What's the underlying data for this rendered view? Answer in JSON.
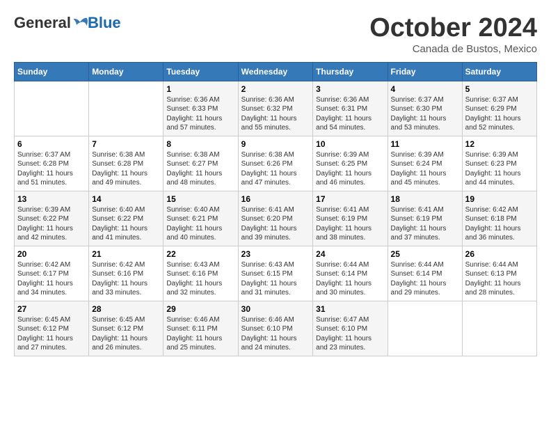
{
  "logo": {
    "general": "General",
    "blue": "Blue"
  },
  "title": "October 2024",
  "subtitle": "Canada de Bustos, Mexico",
  "days": [
    "Sunday",
    "Monday",
    "Tuesday",
    "Wednesday",
    "Thursday",
    "Friday",
    "Saturday"
  ],
  "weeks": [
    [
      {
        "day": "",
        "sunrise": "",
        "sunset": "",
        "daylight": ""
      },
      {
        "day": "",
        "sunrise": "",
        "sunset": "",
        "daylight": ""
      },
      {
        "day": "1",
        "sunrise": "Sunrise: 6:36 AM",
        "sunset": "Sunset: 6:33 PM",
        "daylight": "Daylight: 11 hours and 57 minutes."
      },
      {
        "day": "2",
        "sunrise": "Sunrise: 6:36 AM",
        "sunset": "Sunset: 6:32 PM",
        "daylight": "Daylight: 11 hours and 55 minutes."
      },
      {
        "day": "3",
        "sunrise": "Sunrise: 6:36 AM",
        "sunset": "Sunset: 6:31 PM",
        "daylight": "Daylight: 11 hours and 54 minutes."
      },
      {
        "day": "4",
        "sunrise": "Sunrise: 6:37 AM",
        "sunset": "Sunset: 6:30 PM",
        "daylight": "Daylight: 11 hours and 53 minutes."
      },
      {
        "day": "5",
        "sunrise": "Sunrise: 6:37 AM",
        "sunset": "Sunset: 6:29 PM",
        "daylight": "Daylight: 11 hours and 52 minutes."
      }
    ],
    [
      {
        "day": "6",
        "sunrise": "Sunrise: 6:37 AM",
        "sunset": "Sunset: 6:28 PM",
        "daylight": "Daylight: 11 hours and 51 minutes."
      },
      {
        "day": "7",
        "sunrise": "Sunrise: 6:38 AM",
        "sunset": "Sunset: 6:28 PM",
        "daylight": "Daylight: 11 hours and 49 minutes."
      },
      {
        "day": "8",
        "sunrise": "Sunrise: 6:38 AM",
        "sunset": "Sunset: 6:27 PM",
        "daylight": "Daylight: 11 hours and 48 minutes."
      },
      {
        "day": "9",
        "sunrise": "Sunrise: 6:38 AM",
        "sunset": "Sunset: 6:26 PM",
        "daylight": "Daylight: 11 hours and 47 minutes."
      },
      {
        "day": "10",
        "sunrise": "Sunrise: 6:39 AM",
        "sunset": "Sunset: 6:25 PM",
        "daylight": "Daylight: 11 hours and 46 minutes."
      },
      {
        "day": "11",
        "sunrise": "Sunrise: 6:39 AM",
        "sunset": "Sunset: 6:24 PM",
        "daylight": "Daylight: 11 hours and 45 minutes."
      },
      {
        "day": "12",
        "sunrise": "Sunrise: 6:39 AM",
        "sunset": "Sunset: 6:23 PM",
        "daylight": "Daylight: 11 hours and 44 minutes."
      }
    ],
    [
      {
        "day": "13",
        "sunrise": "Sunrise: 6:39 AM",
        "sunset": "Sunset: 6:22 PM",
        "daylight": "Daylight: 11 hours and 42 minutes."
      },
      {
        "day": "14",
        "sunrise": "Sunrise: 6:40 AM",
        "sunset": "Sunset: 6:22 PM",
        "daylight": "Daylight: 11 hours and 41 minutes."
      },
      {
        "day": "15",
        "sunrise": "Sunrise: 6:40 AM",
        "sunset": "Sunset: 6:21 PM",
        "daylight": "Daylight: 11 hours and 40 minutes."
      },
      {
        "day": "16",
        "sunrise": "Sunrise: 6:41 AM",
        "sunset": "Sunset: 6:20 PM",
        "daylight": "Daylight: 11 hours and 39 minutes."
      },
      {
        "day": "17",
        "sunrise": "Sunrise: 6:41 AM",
        "sunset": "Sunset: 6:19 PM",
        "daylight": "Daylight: 11 hours and 38 minutes."
      },
      {
        "day": "18",
        "sunrise": "Sunrise: 6:41 AM",
        "sunset": "Sunset: 6:19 PM",
        "daylight": "Daylight: 11 hours and 37 minutes."
      },
      {
        "day": "19",
        "sunrise": "Sunrise: 6:42 AM",
        "sunset": "Sunset: 6:18 PM",
        "daylight": "Daylight: 11 hours and 36 minutes."
      }
    ],
    [
      {
        "day": "20",
        "sunrise": "Sunrise: 6:42 AM",
        "sunset": "Sunset: 6:17 PM",
        "daylight": "Daylight: 11 hours and 34 minutes."
      },
      {
        "day": "21",
        "sunrise": "Sunrise: 6:42 AM",
        "sunset": "Sunset: 6:16 PM",
        "daylight": "Daylight: 11 hours and 33 minutes."
      },
      {
        "day": "22",
        "sunrise": "Sunrise: 6:43 AM",
        "sunset": "Sunset: 6:16 PM",
        "daylight": "Daylight: 11 hours and 32 minutes."
      },
      {
        "day": "23",
        "sunrise": "Sunrise: 6:43 AM",
        "sunset": "Sunset: 6:15 PM",
        "daylight": "Daylight: 11 hours and 31 minutes."
      },
      {
        "day": "24",
        "sunrise": "Sunrise: 6:44 AM",
        "sunset": "Sunset: 6:14 PM",
        "daylight": "Daylight: 11 hours and 30 minutes."
      },
      {
        "day": "25",
        "sunrise": "Sunrise: 6:44 AM",
        "sunset": "Sunset: 6:14 PM",
        "daylight": "Daylight: 11 hours and 29 minutes."
      },
      {
        "day": "26",
        "sunrise": "Sunrise: 6:44 AM",
        "sunset": "Sunset: 6:13 PM",
        "daylight": "Daylight: 11 hours and 28 minutes."
      }
    ],
    [
      {
        "day": "27",
        "sunrise": "Sunrise: 6:45 AM",
        "sunset": "Sunset: 6:12 PM",
        "daylight": "Daylight: 11 hours and 27 minutes."
      },
      {
        "day": "28",
        "sunrise": "Sunrise: 6:45 AM",
        "sunset": "Sunset: 6:12 PM",
        "daylight": "Daylight: 11 hours and 26 minutes."
      },
      {
        "day": "29",
        "sunrise": "Sunrise: 6:46 AM",
        "sunset": "Sunset: 6:11 PM",
        "daylight": "Daylight: 11 hours and 25 minutes."
      },
      {
        "day": "30",
        "sunrise": "Sunrise: 6:46 AM",
        "sunset": "Sunset: 6:10 PM",
        "daylight": "Daylight: 11 hours and 24 minutes."
      },
      {
        "day": "31",
        "sunrise": "Sunrise: 6:47 AM",
        "sunset": "Sunset: 6:10 PM",
        "daylight": "Daylight: 11 hours and 23 minutes."
      },
      {
        "day": "",
        "sunrise": "",
        "sunset": "",
        "daylight": ""
      },
      {
        "day": "",
        "sunrise": "",
        "sunset": "",
        "daylight": ""
      }
    ]
  ]
}
